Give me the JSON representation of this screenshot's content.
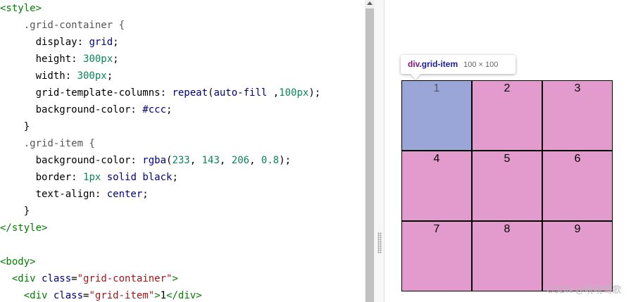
{
  "editor": {
    "lines": [
      [
        [
          "tag",
          "<style>"
        ]
      ],
      [
        [
          "sel",
          "    .grid-container {"
        ]
      ],
      [
        [
          "prop",
          "      display: "
        ],
        [
          "kw",
          "grid"
        ],
        [
          "txt",
          ";"
        ]
      ],
      [
        [
          "prop",
          "      height: "
        ],
        [
          "num",
          "300px"
        ],
        [
          "txt",
          ";"
        ]
      ],
      [
        [
          "prop",
          "      width: "
        ],
        [
          "num",
          "300px"
        ],
        [
          "txt",
          ";"
        ]
      ],
      [
        [
          "prop",
          "      grid-template-columns: "
        ],
        [
          "fn",
          "repeat"
        ],
        [
          "txt",
          "("
        ],
        [
          "kw",
          "auto-fill"
        ],
        [
          "txt",
          " ,"
        ],
        [
          "num",
          "100px"
        ],
        [
          "txt",
          ");"
        ]
      ],
      [
        [
          "prop",
          "      background-color: "
        ],
        [
          "kw",
          "#ccc"
        ],
        [
          "txt",
          ";"
        ]
      ],
      [
        [
          "txt",
          "    }"
        ]
      ],
      [
        [
          "sel",
          "    .grid-item {"
        ]
      ],
      [
        [
          "prop",
          "      background-color: "
        ],
        [
          "fn",
          "rgba"
        ],
        [
          "txt",
          "("
        ],
        [
          "num",
          "233"
        ],
        [
          "txt",
          ", "
        ],
        [
          "num",
          "143"
        ],
        [
          "txt",
          ", "
        ],
        [
          "num",
          "206"
        ],
        [
          "txt",
          ", "
        ],
        [
          "num",
          "0.8"
        ],
        [
          "txt",
          ");"
        ]
      ],
      [
        [
          "prop",
          "      border: "
        ],
        [
          "num",
          "1px"
        ],
        [
          "kw",
          " solid"
        ],
        [
          "kw",
          " black"
        ],
        [
          "txt",
          ";"
        ]
      ],
      [
        [
          "prop",
          "      text-align: "
        ],
        [
          "kw",
          "center"
        ],
        [
          "txt",
          ";"
        ]
      ],
      [
        [
          "txt",
          "    }"
        ]
      ],
      [
        [
          "tag",
          "</style>"
        ]
      ],
      [
        [
          "txt",
          ""
        ]
      ],
      [
        [
          "tag",
          "<body>"
        ]
      ],
      [
        [
          "txt",
          "  "
        ],
        [
          "tag",
          "<div "
        ],
        [
          "attr",
          "class"
        ],
        [
          "txt",
          "="
        ],
        [
          "str",
          "\"grid-container\""
        ],
        [
          "tag",
          ">"
        ]
      ],
      [
        [
          "txt",
          "    "
        ],
        [
          "tag",
          "<div "
        ],
        [
          "attr",
          "class"
        ],
        [
          "txt",
          "="
        ],
        [
          "str",
          "\"grid-item\""
        ],
        [
          "tag",
          ">"
        ],
        [
          "txt",
          "1"
        ],
        [
          "tag",
          "</div>"
        ]
      ]
    ]
  },
  "tooltip": {
    "tag": "div",
    "class": ".grid-item",
    "size": "100 × 100"
  },
  "grid": {
    "items": [
      "1",
      "2",
      "3",
      "4",
      "5",
      "6",
      "7",
      "8",
      "9"
    ],
    "highlighted_index": 0
  },
  "colors": {
    "item_bg": "rgba(233,143,206,0.8)",
    "highlight_bg": "#9aa6d8",
    "container_bg": "#cccccc"
  },
  "watermark": "CSDN @晓晓莺歌"
}
